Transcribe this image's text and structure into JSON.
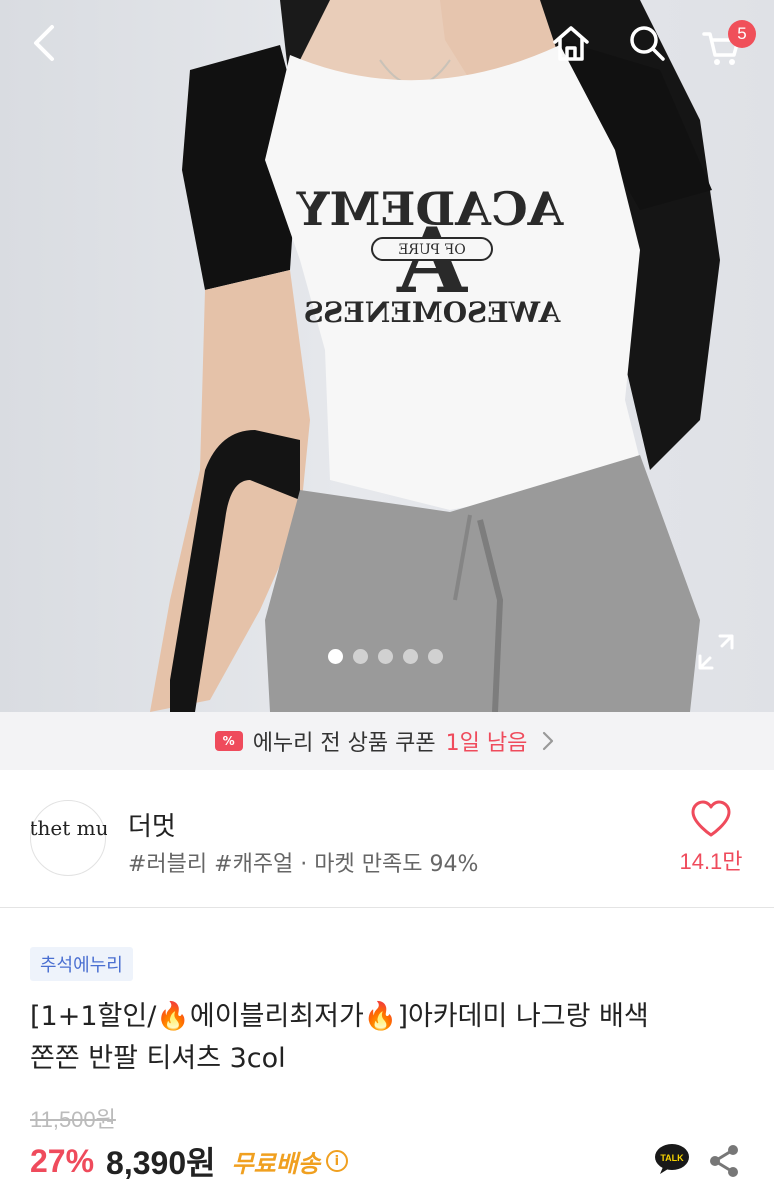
{
  "header": {
    "back_icon": "chevron-left-icon",
    "home_icon": "home-icon",
    "search_icon": "search-icon",
    "cart_icon": "cart-icon",
    "cart_count": "5"
  },
  "gallery": {
    "photo_text": {
      "line1": "ACADEMY",
      "letter": "A",
      "banner": "OF PURE",
      "line3": "AWESOMENESS"
    },
    "slide_count": 5,
    "active_slide": 1,
    "expand_icon": "expand-icon"
  },
  "coupon": {
    "icon": "%",
    "text": "에누리 전 상품 쿠폰",
    "highlight": "1일 남음"
  },
  "shop": {
    "logo_text": "thet mu",
    "name": "더멋",
    "tags": "#러블리 #캐주얼 · 마켓 만족도 94%",
    "like_count": "14.1만"
  },
  "product": {
    "badge": "추석에누리",
    "title_part1": "[1+1할인/",
    "title_part2": "에이블리최저가",
    "title_part3": "]아카데미 나그랑 배색",
    "title_line2": "쫀쫀 반팔 티셔츠 3col",
    "original_price": "11,500원",
    "discount": "27%",
    "price": "8,390원",
    "shipping": "무료배송",
    "talk_label": "TALK"
  },
  "colors": {
    "accent": "#ef4b5c",
    "shipping": "#f0a020",
    "badge_text": "#4a6fd1"
  }
}
